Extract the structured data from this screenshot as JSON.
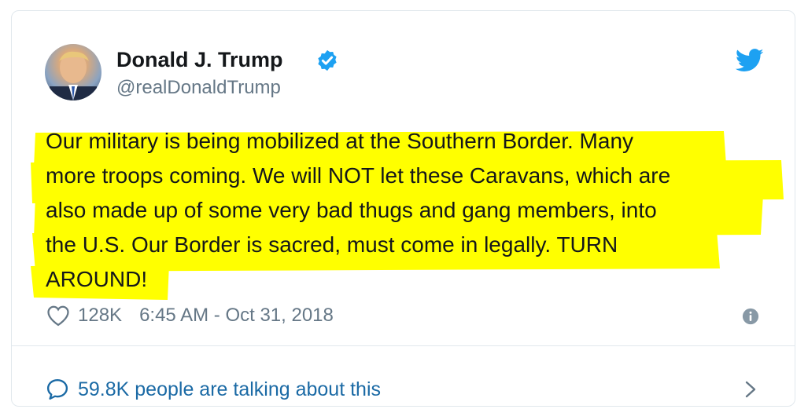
{
  "user": {
    "name": "Donald J. Trump",
    "handle": "@realDonaldTrump"
  },
  "tweet": {
    "text": "Our military is being mobilized at the Southern Border. Many\nmore troops coming. We will NOT let these Caravans, which are\nalso made up of some very bad thugs and gang members, into\nthe U.S. Our Border is sacred, must come in legally. TURN\nAROUND!",
    "likes": "128K",
    "timestamp": "6:45 AM - Oct 31, 2018"
  },
  "footer": {
    "talking": "59.8K people are talking about this"
  },
  "colors": {
    "twitter_blue": "#1da1f2",
    "highlight": "#ffff00",
    "link_blue": "#1b6aa5",
    "muted": "#657786"
  },
  "icons": [
    "verified-badge-icon",
    "twitter-bird-icon",
    "heart-icon",
    "info-icon",
    "speech-bubble-icon",
    "chevron-right-icon"
  ]
}
